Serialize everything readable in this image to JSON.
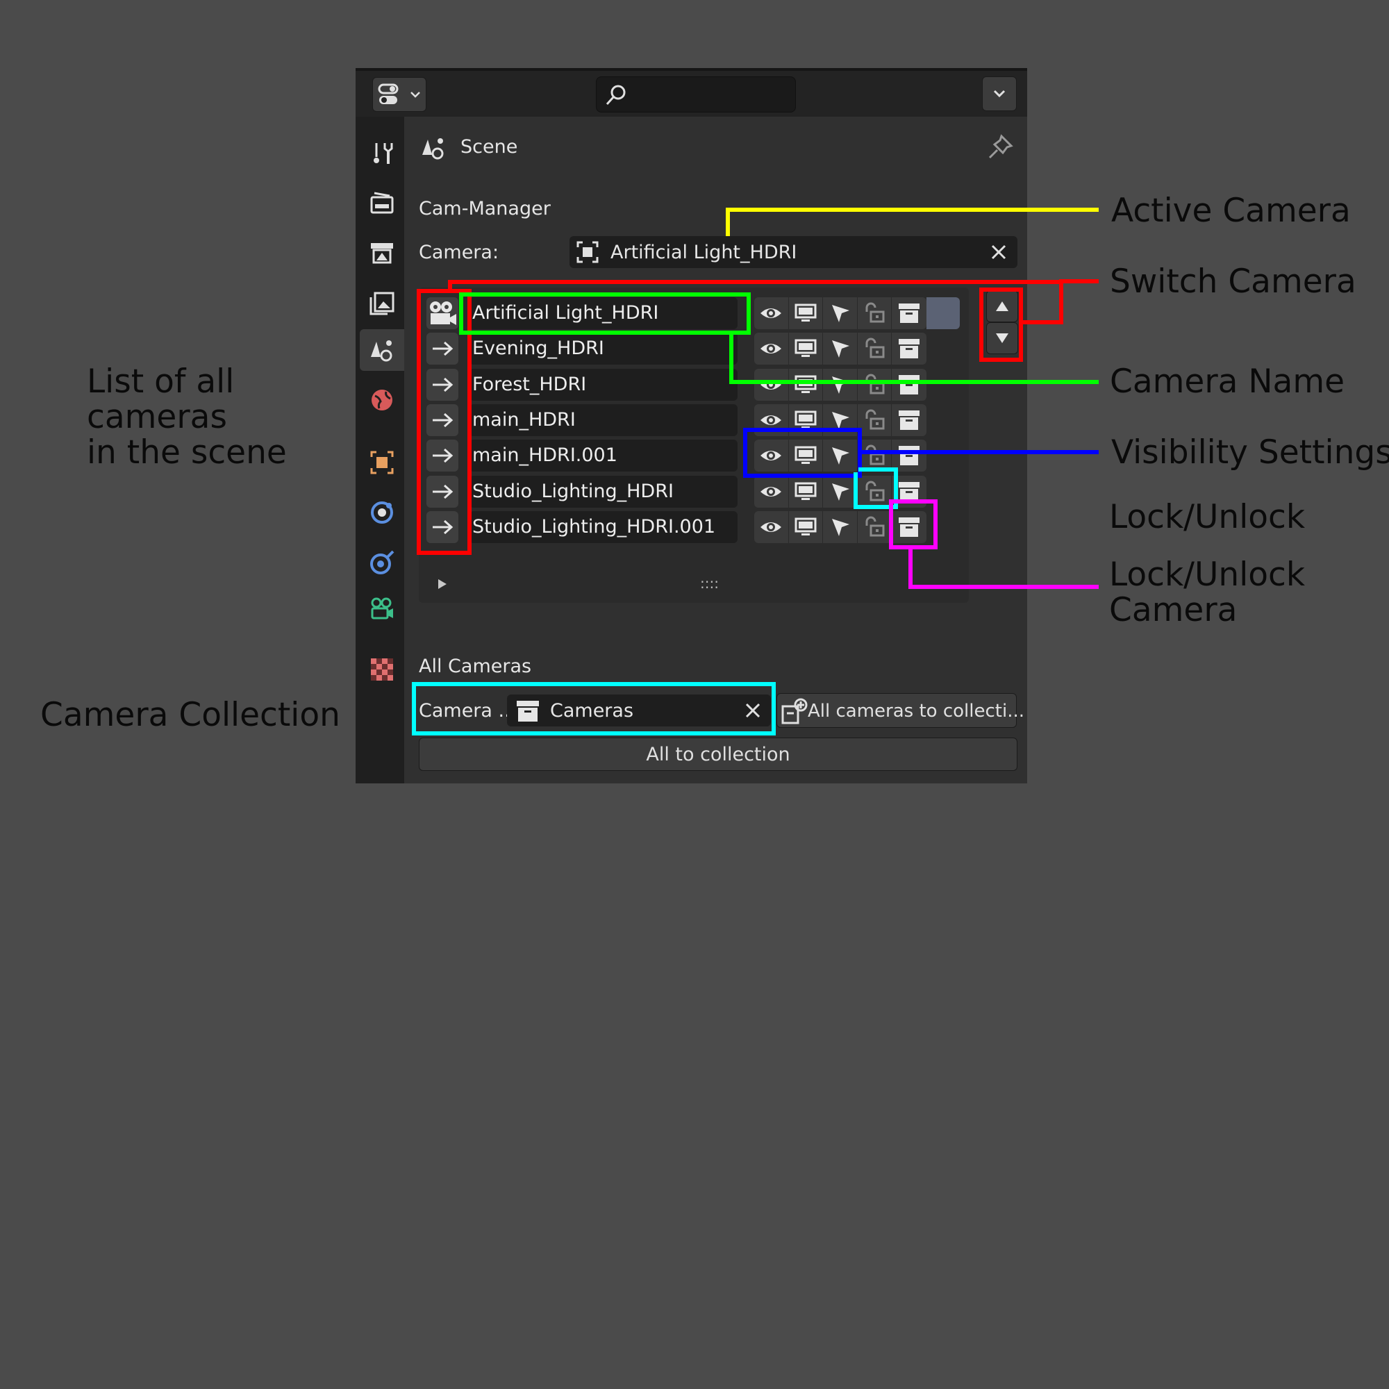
{
  "header": {
    "search_placeholder": ""
  },
  "properties": {
    "context_title": "Scene",
    "panel_title": "Cam-Manager",
    "camera_label": "Camera:",
    "active_camera": "Artificial Light_HDRI",
    "cameras": [
      {
        "name": "Artificial Light_HDRI",
        "active": true
      },
      {
        "name": "Evening_HDRI",
        "active": false
      },
      {
        "name": "Forest_HDRI",
        "active": false
      },
      {
        "name": "main_HDRI",
        "active": false
      },
      {
        "name": "main_HDRI.001",
        "active": false
      },
      {
        "name": "Studio_Lighting_HDRI",
        "active": false
      },
      {
        "name": "Studio_Lighting_HDRI.001",
        "active": false
      }
    ],
    "list_grip": "::::",
    "all_cameras_title": "All Cameras",
    "collection_label": "Camera ...",
    "collection_value": "Cameras",
    "all_cameras_to_collection": "All cameras to collecti...",
    "all_to_collection": "All to collection"
  },
  "annotations": {
    "active_camera": "Active Camera",
    "switch_camera": "Switch Camera",
    "camera_name": "Camera Name",
    "visibility_settings": "Visibility Settings",
    "lock_unlock": "Lock/Unlock",
    "lock_unlock_camera_line1": "Lock/Unlock",
    "lock_unlock_camera_line2": "Camera",
    "list_line1": "List of all",
    "list_line2": "cameras",
    "list_line3": "in the scene",
    "camera_collection": "Camera Collection"
  },
  "colors": {
    "background": "#4b4b4b",
    "panel": "#303030",
    "yellow": "#ffff00",
    "red": "#ff0000",
    "green": "#00ff00",
    "blue": "#0000ff",
    "cyan": "#00ffff",
    "magenta": "#ff00ff"
  },
  "icons": [
    "editor-type-icon",
    "search-icon",
    "chevron-down-icon",
    "tool-icon",
    "render-icon",
    "output-icon",
    "view-layer-icon",
    "scene-icon",
    "world-icon",
    "object-icon",
    "modifier-icon",
    "physics-icon",
    "object-data-camera-icon",
    "texture-icon",
    "pin-icon",
    "camera-object-icon",
    "eye-icon",
    "monitor-icon",
    "cursor-icon",
    "lock-icon",
    "collection-icon",
    "arrow-up-icon",
    "arrow-down-icon",
    "close-icon"
  ]
}
